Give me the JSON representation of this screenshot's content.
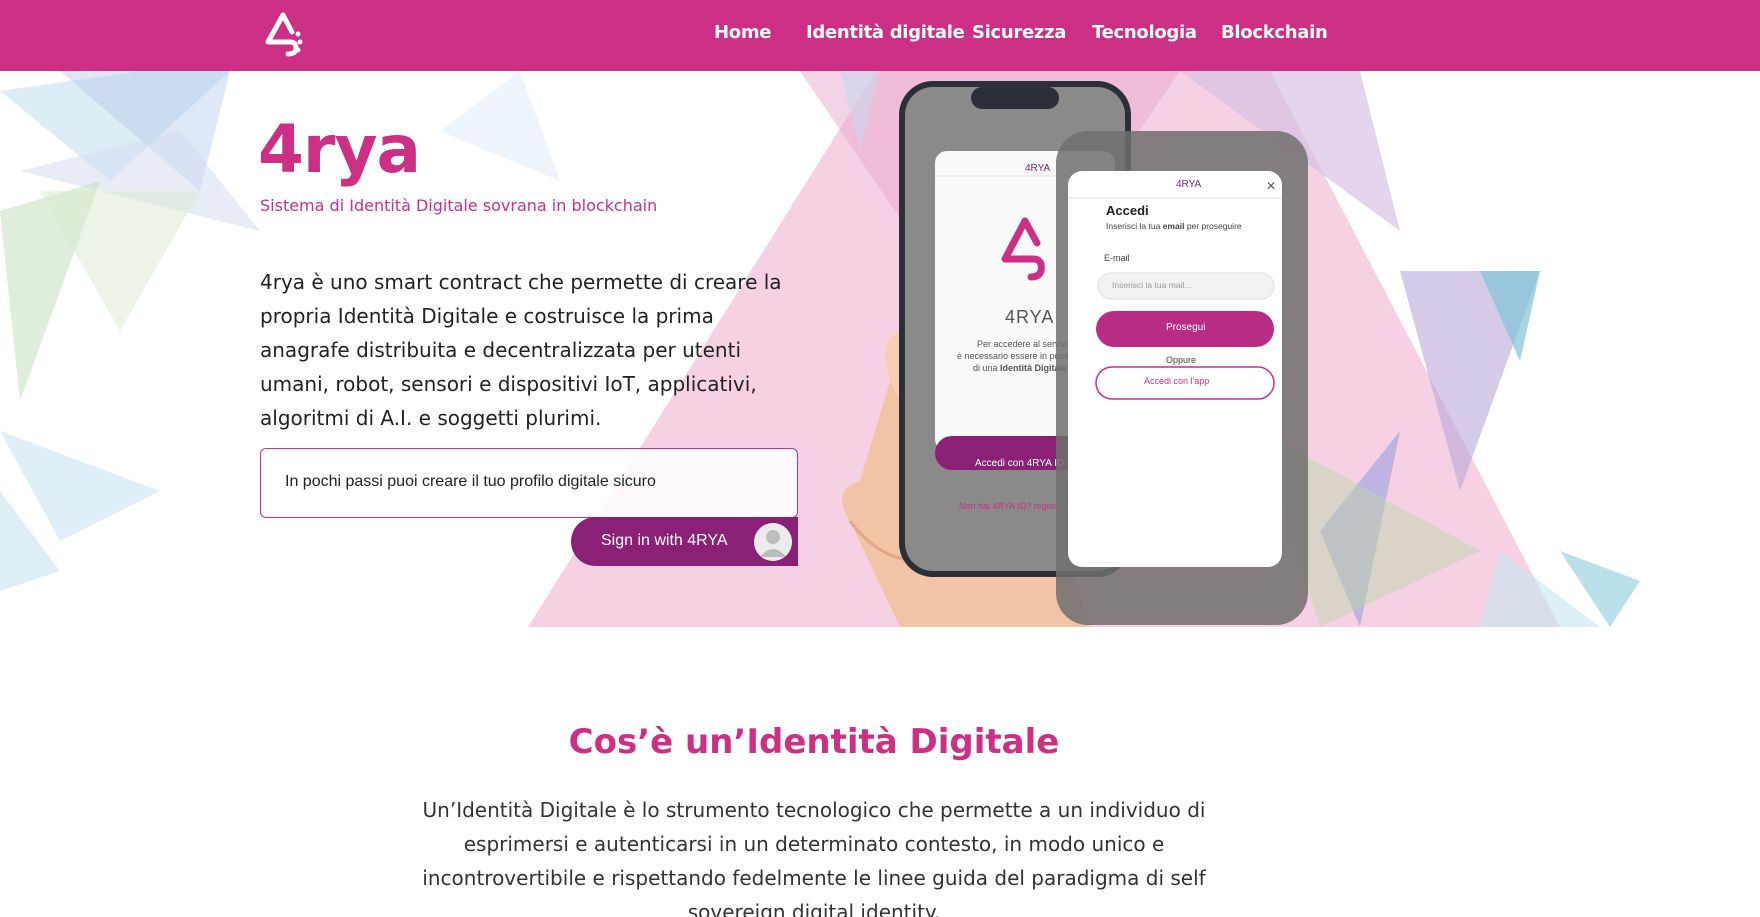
{
  "nav": {
    "logo_name": "4rya-logo-icon",
    "items": [
      {
        "label": "Home"
      },
      {
        "label": "Identità digitale"
      },
      {
        "label": "Sicurezza"
      },
      {
        "label": "Tecnologia"
      },
      {
        "label": "Blockchain"
      }
    ]
  },
  "hero": {
    "title": "4rya",
    "subtitle": "Sistema di Identità Digitale sovrana in blockchain",
    "description": "4rya è uno smart contract che permette di creare la propria Identità Digitale e costruisce la prima anagrafe distribuita e decentralizzata per utenti umani, robot, sensori e dispositivi IoT, applicativi, algoritmi di A.I. e soggetti plurimi.",
    "cta_text": "In pochi passi puoi creare il tuo profilo digitale sicuro",
    "signin_label": "Sign in with 4RYA"
  },
  "phone_front": {
    "header_logo": "4RYA",
    "brand": "4RYA",
    "info_line1": "Per accedere al servizio",
    "info_line2": "è necessario essere in poss",
    "info_line3_prefix": "di una ",
    "info_line3_bold": "Identità Digitale",
    "button": "Accedi con 4RYA ID",
    "register_link": "Non hai 4RYA ID? registr"
  },
  "phone_back": {
    "header_logo": "4RYA",
    "heading": "Accedi",
    "instruction_prefix": "Inserisci la tua ",
    "instruction_bold": "email",
    "instruction_suffix": " per proseguire",
    "email_label": "E-mail",
    "email_placeholder": "Inserisci la tua mail...",
    "continue_button": "Prosegui",
    "or_text": "Oppure",
    "app_button": "Accedi con l'app"
  },
  "section2": {
    "title": "Cos’è un’Identità Digitale",
    "body": "Un’Identità Digitale è lo strumento tecnologico che permette a un individuo di esprimersi e autenticarsi in un determinato contesto, in modo unico e incontrovertibile e rispettando fedelmente le linee guida del paradigma di self sovereign digital identity."
  },
  "colors": {
    "brand": "#cc2f83",
    "brand_dark": "#8b2176",
    "nav_text": "#ffffff"
  }
}
